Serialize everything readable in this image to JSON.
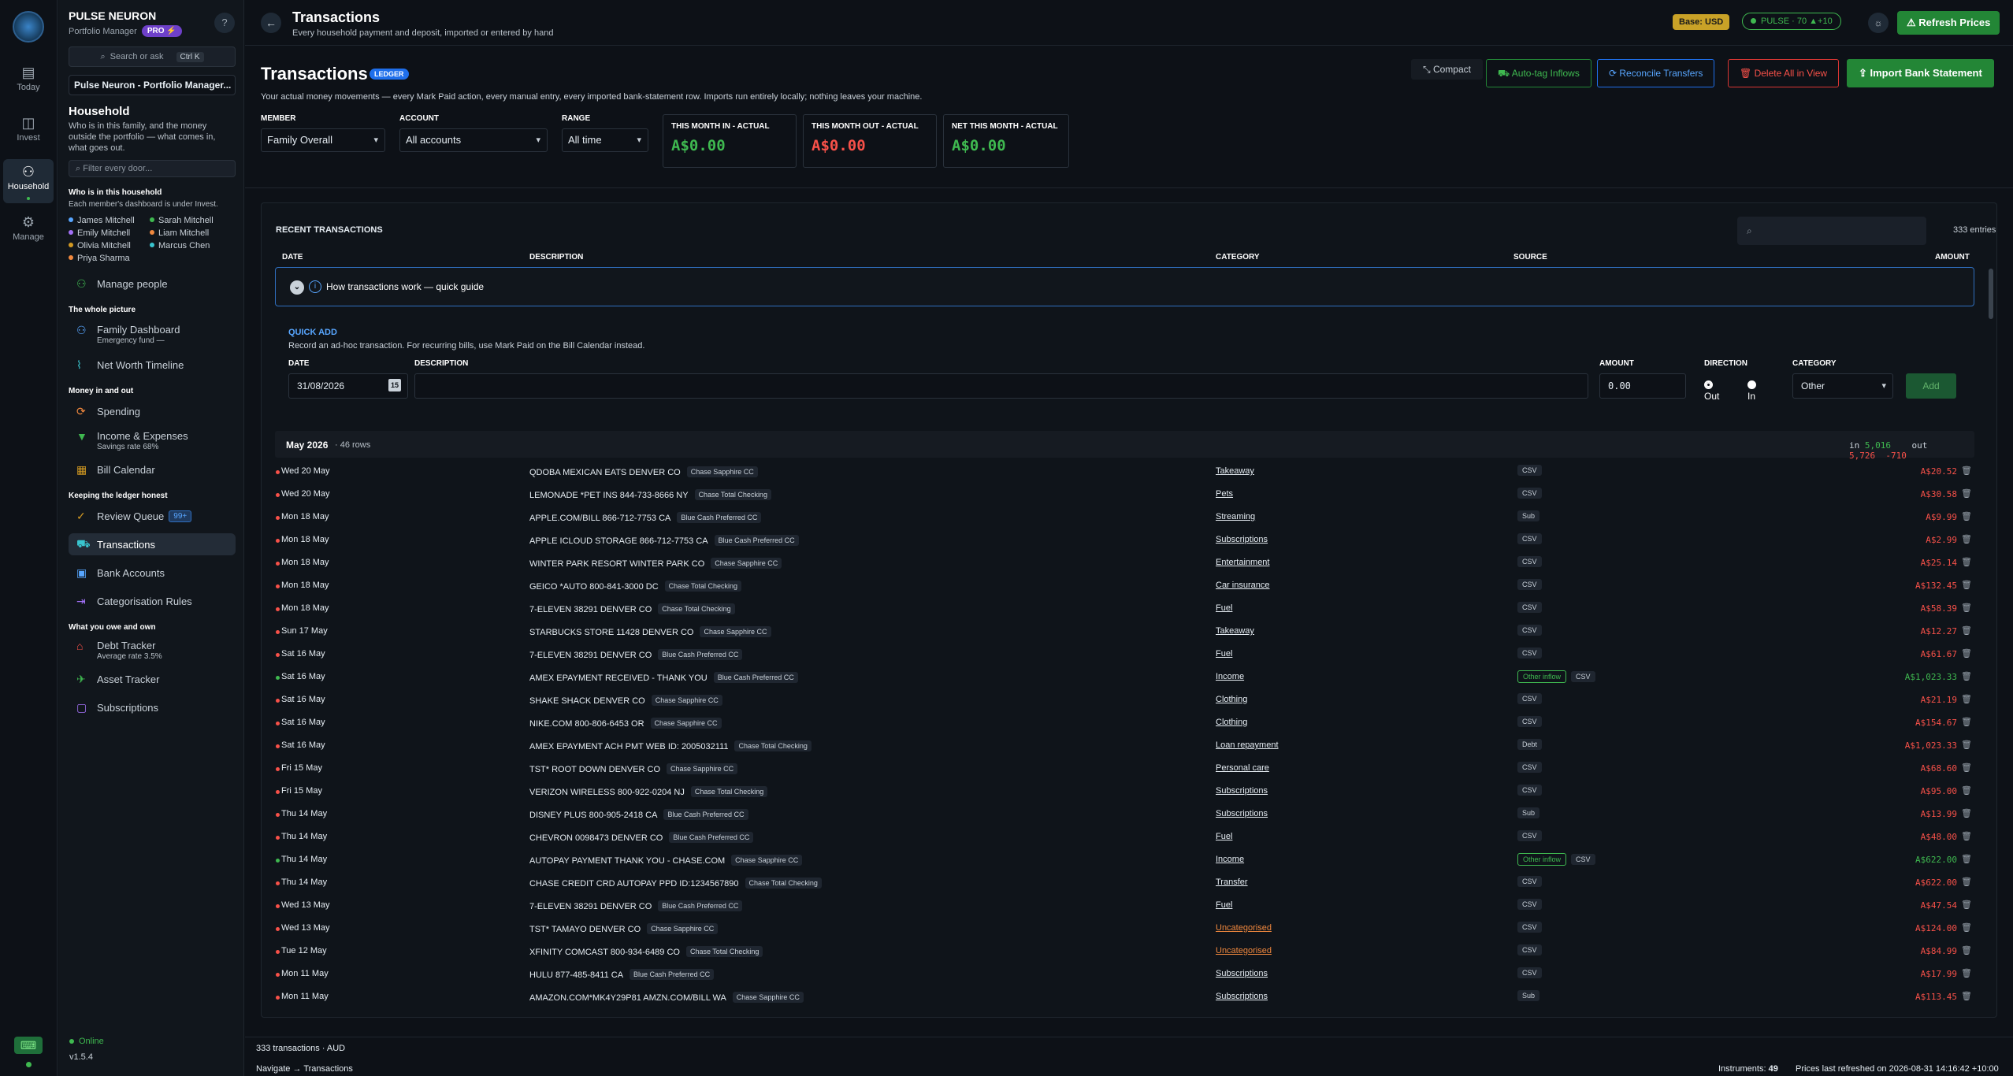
{
  "rail": {
    "items": [
      {
        "label": "Today",
        "icon": "calendar-icon"
      },
      {
        "label": "Invest",
        "icon": "chart-icon"
      },
      {
        "label": "Household",
        "icon": "people-icon"
      },
      {
        "label": "Manage",
        "icon": "gear-icon"
      }
    ]
  },
  "sidebar": {
    "brand": "PULSE NEURON",
    "subtitle": "Portfolio Manager",
    "pro": "PRO ⚡",
    "help": "?",
    "search": "Search or ask",
    "search_kbd": "Ctrl K",
    "portfolio": "Pulse Neuron - Portfolio Manager...",
    "hh_title": "Household",
    "hh_desc": "Who is in this family, and the money outside the portfolio — what comes in, what goes out.",
    "filter": "Filter every door...",
    "who_title": "Who is in this household",
    "who_desc": "Each member's dashboard is under Invest.",
    "people": [
      {
        "name": "James Mitchell",
        "color": "#58a6ff"
      },
      {
        "name": "Sarah Mitchell",
        "color": "#3fb950"
      },
      {
        "name": "Emily Mitchell",
        "color": "#a371f7"
      },
      {
        "name": "Liam Mitchell",
        "color": "#f0883e"
      },
      {
        "name": "Olivia Mitchell",
        "color": "#d29922"
      },
      {
        "name": "Marcus Chen",
        "color": "#39c5cf"
      },
      {
        "name": "Priya Sharma",
        "color": "#f0883e"
      }
    ],
    "manage_people": "Manage people",
    "whole_title": "The whole picture",
    "family_dashboard": "Family Dashboard",
    "family_sub": "Emergency fund  —",
    "net_worth": "Net Worth Timeline",
    "money_title": "Money in and out",
    "spending": "Spending",
    "income": "Income & Expenses",
    "income_sub": "Savings rate  68%",
    "bill": "Bill Calendar",
    "ledger_title": "Keeping the ledger honest",
    "review": "Review Queue",
    "review_badge": "99+",
    "transactions": "Transactions",
    "bank": "Bank Accounts",
    "rules": "Categorisation Rules",
    "owe_title": "What you owe and own",
    "debt": "Debt Tracker",
    "debt_sub": "Average rate  3.5%",
    "asset": "Asset Tracker",
    "subs": "Subscriptions",
    "online": "Online",
    "version": "v1.5.4"
  },
  "topbar": {
    "title": "Transactions",
    "subtitle": "Every household payment and deposit, imported or entered by hand",
    "base": "Base: USD",
    "pulse": "PULSE · 70  ▲+10",
    "refresh": "Refresh Prices"
  },
  "header": {
    "title": "Transactions",
    "ledger": "LEDGER",
    "desc": "Your actual money movements — every Mark Paid action, every manual entry, every imported bank-statement row. Imports run entirely locally; nothing leaves your machine.",
    "compact": "Compact",
    "autotag": "Auto-tag Inflows",
    "reconcile": "Reconcile Transfers",
    "delete_all": "Delete All in View",
    "import": "Import Bank Statement",
    "member_label": "MEMBER",
    "member": "Family Overall",
    "account_label": "ACCOUNT",
    "account": "All accounts",
    "range_label": "RANGE",
    "range": "All time",
    "stats": [
      {
        "label": "THIS MONTH IN - ACTUAL",
        "value": "A$0.00"
      },
      {
        "label": "THIS MONTH OUT - ACTUAL",
        "value": "A$0.00"
      },
      {
        "label": "NET THIS MONTH - ACTUAL",
        "value": "A$0.00"
      }
    ]
  },
  "panel": {
    "title": "RECENT TRANSACTIONS",
    "count": "333 entries",
    "cols": {
      "date": "DATE",
      "desc": "DESCRIPTION",
      "cat": "CATEGORY",
      "src": "SOURCE",
      "amt": "AMOUNT"
    },
    "guide": "How transactions work — quick guide",
    "qa": {
      "title": "QUICK ADD",
      "desc": "Record an ad-hoc transaction. For recurring bills, use Mark Paid on the Bill Calendar instead.",
      "date_label": "DATE",
      "date": "31/08/2026",
      "desc_label": "DESCRIPTION",
      "amount_label": "AMOUNT",
      "amount": "0.00",
      "dir_label": "DIRECTION",
      "out": "Out",
      "in": "In",
      "cat_label": "CATEGORY",
      "cat": "Other",
      "add": "Add"
    },
    "group": {
      "month": "May 2026",
      "rows": "·  46 rows",
      "in_label": "in",
      "in": "5,016",
      "out_label": "out",
      "out": "5,726",
      "net": "-710"
    }
  },
  "rows": [
    {
      "date": "Wed 20 May",
      "desc": "QDOBA MEXICAN EATS DENVER CO",
      "acct": "Chase Sapphire CC",
      "cat": "Takeaway",
      "src": [
        "CSV"
      ],
      "amt": "A$20.52",
      "dir": "out"
    },
    {
      "date": "Wed 20 May",
      "desc": "LEMONADE *PET INS 844-733-8666 NY",
      "acct": "Chase Total Checking",
      "cat": "Pets",
      "src": [
        "CSV"
      ],
      "amt": "A$30.58",
      "dir": "out"
    },
    {
      "date": "Mon 18 May",
      "desc": "APPLE.COM/BILL 866-712-7753 CA",
      "acct": "Blue Cash Preferred CC",
      "cat": "Streaming",
      "src": [
        "Sub"
      ],
      "amt": "A$9.99",
      "dir": "out"
    },
    {
      "date": "Mon 18 May",
      "desc": "APPLE ICLOUD STORAGE 866-712-7753 CA",
      "acct": "Blue Cash Preferred CC",
      "cat": "Subscriptions",
      "src": [
        "CSV"
      ],
      "amt": "A$2.99",
      "dir": "out"
    },
    {
      "date": "Mon 18 May",
      "desc": "WINTER PARK RESORT WINTER PARK CO",
      "acct": "Chase Sapphire CC",
      "cat": "Entertainment",
      "src": [
        "CSV"
      ],
      "amt": "A$25.14",
      "dir": "out"
    },
    {
      "date": "Mon 18 May",
      "desc": "GEICO *AUTO 800-841-3000 DC",
      "acct": "Chase Total Checking",
      "cat": "Car insurance",
      "src": [
        "CSV"
      ],
      "amt": "A$132.45",
      "dir": "out"
    },
    {
      "date": "Mon 18 May",
      "desc": "7-ELEVEN 38291 DENVER CO",
      "acct": "Chase Total Checking",
      "cat": "Fuel",
      "src": [
        "CSV"
      ],
      "amt": "A$58.39",
      "dir": "out"
    },
    {
      "date": "Sun 17 May",
      "desc": "STARBUCKS STORE 11428 DENVER CO",
      "acct": "Chase Sapphire CC",
      "cat": "Takeaway",
      "src": [
        "CSV"
      ],
      "amt": "A$12.27",
      "dir": "out"
    },
    {
      "date": "Sat 16 May",
      "desc": "7-ELEVEN 38291 DENVER CO",
      "acct": "Blue Cash Preferred CC",
      "cat": "Fuel",
      "src": [
        "CSV"
      ],
      "amt": "A$61.67",
      "dir": "out"
    },
    {
      "date": "Sat 16 May",
      "desc": "AMEX EPAYMENT RECEIVED - THANK YOU",
      "acct": "Blue Cash Preferred CC",
      "cat": "Income",
      "src": [
        "Other inflow",
        "CSV"
      ],
      "amt": "A$1,023.33",
      "dir": "in"
    },
    {
      "date": "Sat 16 May",
      "desc": "SHAKE SHACK DENVER CO",
      "acct": "Chase Sapphire CC",
      "cat": "Clothing",
      "src": [
        "CSV"
      ],
      "amt": "A$21.19",
      "dir": "out"
    },
    {
      "date": "Sat 16 May",
      "desc": "NIKE.COM 800-806-6453 OR",
      "acct": "Chase Sapphire CC",
      "cat": "Clothing",
      "src": [
        "CSV"
      ],
      "amt": "A$154.67",
      "dir": "out"
    },
    {
      "date": "Sat 16 May",
      "desc": "AMEX EPAYMENT ACH PMT WEB ID: 2005032111",
      "acct": "Chase Total Checking",
      "cat": "Loan repayment",
      "src": [
        "Debt"
      ],
      "amt": "A$1,023.33",
      "dir": "out"
    },
    {
      "date": "Fri 15 May",
      "desc": "TST* ROOT DOWN DENVER CO",
      "acct": "Chase Sapphire CC",
      "cat": "Personal care",
      "src": [
        "CSV"
      ],
      "amt": "A$68.60",
      "dir": "out"
    },
    {
      "date": "Fri 15 May",
      "desc": "VERIZON WIRELESS 800-922-0204 NJ",
      "acct": "Chase Total Checking",
      "cat": "Subscriptions",
      "src": [
        "CSV"
      ],
      "amt": "A$95.00",
      "dir": "out"
    },
    {
      "date": "Thu 14 May",
      "desc": "DISNEY PLUS 800-905-2418 CA",
      "acct": "Blue Cash Preferred CC",
      "cat": "Subscriptions",
      "src": [
        "Sub"
      ],
      "amt": "A$13.99",
      "dir": "out"
    },
    {
      "date": "Thu 14 May",
      "desc": "CHEVRON 0098473 DENVER CO",
      "acct": "Blue Cash Preferred CC",
      "cat": "Fuel",
      "src": [
        "CSV"
      ],
      "amt": "A$48.00",
      "dir": "out"
    },
    {
      "date": "Thu 14 May",
      "desc": "AUTOPAY PAYMENT THANK YOU - CHASE.COM",
      "acct": "Chase Sapphire CC",
      "cat": "Income",
      "src": [
        "Other inflow",
        "CSV"
      ],
      "amt": "A$622.00",
      "dir": "in"
    },
    {
      "date": "Thu 14 May",
      "desc": "CHASE CREDIT CRD AUTOPAY PPD ID:1234567890",
      "acct": "Chase Total Checking",
      "cat": "Transfer",
      "src": [
        "CSV"
      ],
      "amt": "A$622.00",
      "dir": "out"
    },
    {
      "date": "Wed 13 May",
      "desc": "7-ELEVEN 38291 DENVER CO",
      "acct": "Blue Cash Preferred CC",
      "cat": "Fuel",
      "src": [
        "CSV"
      ],
      "amt": "A$47.54",
      "dir": "out"
    },
    {
      "date": "Wed 13 May",
      "desc": "TST* TAMAYO DENVER CO",
      "acct": "Chase Sapphire CC",
      "cat": "Uncategorised",
      "src": [
        "CSV"
      ],
      "amt": "A$124.00",
      "dir": "out",
      "unc": true
    },
    {
      "date": "Tue 12 May",
      "desc": "XFINITY COMCAST 800-934-6489 CO",
      "acct": "Chase Total Checking",
      "cat": "Uncategorised",
      "src": [
        "CSV"
      ],
      "amt": "A$84.99",
      "dir": "out",
      "unc": true
    },
    {
      "date": "Mon 11 May",
      "desc": "HULU 877-485-8411 CA",
      "acct": "Blue Cash Preferred CC",
      "cat": "Subscriptions",
      "src": [
        "CSV"
      ],
      "amt": "A$17.99",
      "dir": "out"
    },
    {
      "date": "Mon 11 May",
      "desc": "AMAZON.COM*MK4Y29P81 AMZN.COM/BILL WA",
      "acct": "Chase Sapphire CC",
      "cat": "Subscriptions",
      "src": [
        "Sub"
      ],
      "amt": "A$113.45",
      "dir": "out"
    }
  ],
  "footer": {
    "summary": "333 transactions · AUD",
    "nav": "Navigate → Transactions",
    "instruments_label": "Instruments:",
    "instruments": "49",
    "prices": "Prices last refreshed on 2026-08-31 14:16:42 +10:00"
  }
}
